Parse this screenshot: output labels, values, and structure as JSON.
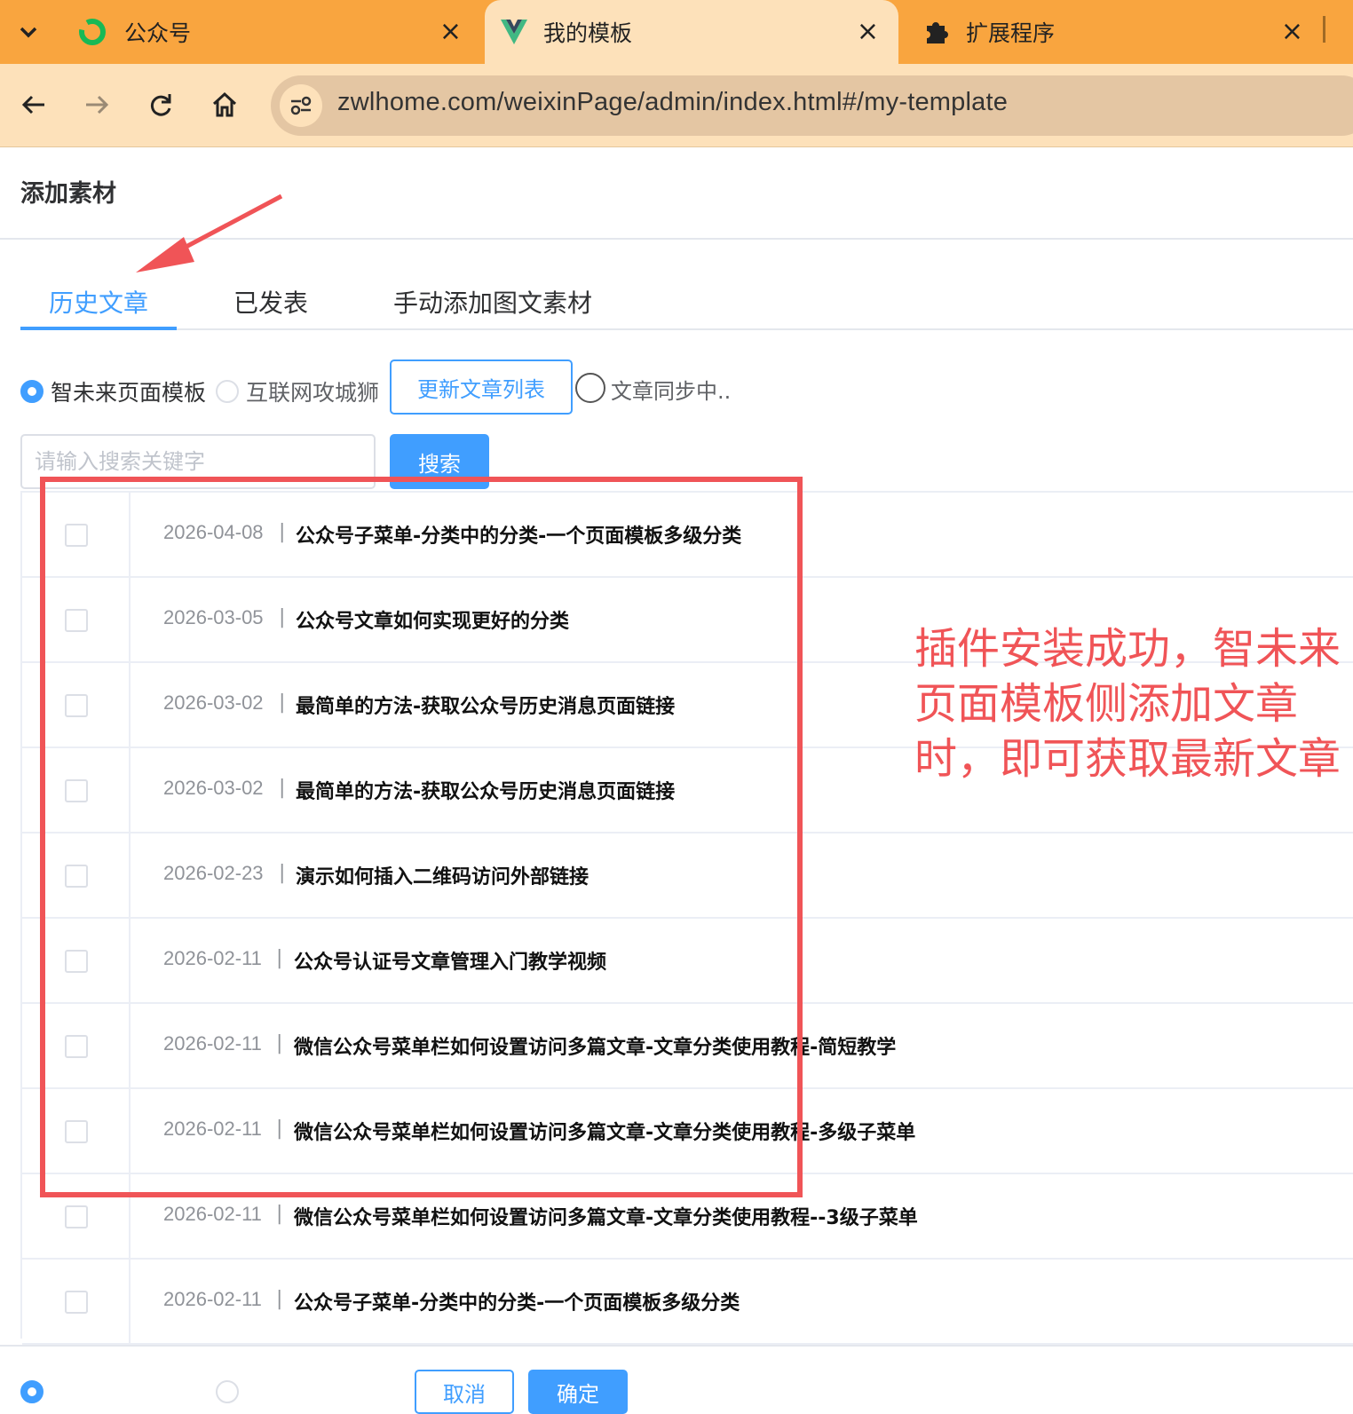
{
  "browser": {
    "tabs": [
      {
        "title": "公众号",
        "icon": "wechat-mp-icon",
        "active": false
      },
      {
        "title": "我的模板",
        "icon": "vue-icon",
        "active": true
      },
      {
        "title": "扩展程序",
        "icon": "puzzle-icon",
        "active": false
      }
    ],
    "tab_close_glyph": "×",
    "url": "zwlhome.com/weixinPage/admin/index.html#/my-template"
  },
  "dialog": {
    "title": "添加素材",
    "tabs": [
      "历史文章",
      "已发表",
      "手动添加图文素材"
    ],
    "active_tab": 0,
    "source_options": [
      {
        "label": "智未来页面模板",
        "checked": true
      },
      {
        "label": "互联网攻城狮",
        "checked": false
      }
    ],
    "update_button": "更新文章列表",
    "sync_status": "文章同步中..",
    "search": {
      "placeholder": "请输入搜索关键字",
      "button": "搜索"
    },
    "separator": "|",
    "articles": [
      {
        "date": "2026-04-08",
        "title": "公众号子菜单-分类中的分类-一个页面模板多级分类"
      },
      {
        "date": "2026-03-05",
        "title": "公众号文章如何实现更好的分类"
      },
      {
        "date": "2026-03-02",
        "title": "最简单的方法-获取公众号历史消息页面链接"
      },
      {
        "date": "2026-03-02",
        "title": "最简单的方法-获取公众号历史消息页面链接"
      },
      {
        "date": "2026-02-23",
        "title": "演示如何插入二维码访问外部链接"
      },
      {
        "date": "2026-02-11",
        "title": "公众号认证号文章管理入门教学视频"
      },
      {
        "date": "2026-02-11",
        "title": "微信公众号菜单栏如何设置访问多篇文章-文章分类使用教程-简短教学"
      },
      {
        "date": "2026-02-11",
        "title": "微信公众号菜单栏如何设置访问多篇文章-文章分类使用教程-多级子菜单"
      },
      {
        "date": "2026-02-11",
        "title": "微信公众号菜单栏如何设置访问多篇文章-文章分类使用教程--3级子菜单"
      },
      {
        "date": "2026-02-11",
        "title": "公众号子菜单-分类中的分类-一个页面模板多级分类"
      }
    ],
    "footer_buttons": [
      "取消",
      "确定"
    ]
  },
  "annotation": {
    "text": "插件安装成功，智未来页面模板侧添加文章时，即可获取最新文章",
    "color": "#f05457"
  },
  "colors": {
    "accent": "#409eff",
    "tabbar": "#f9a53f",
    "toolbar": "#fde1ba"
  }
}
